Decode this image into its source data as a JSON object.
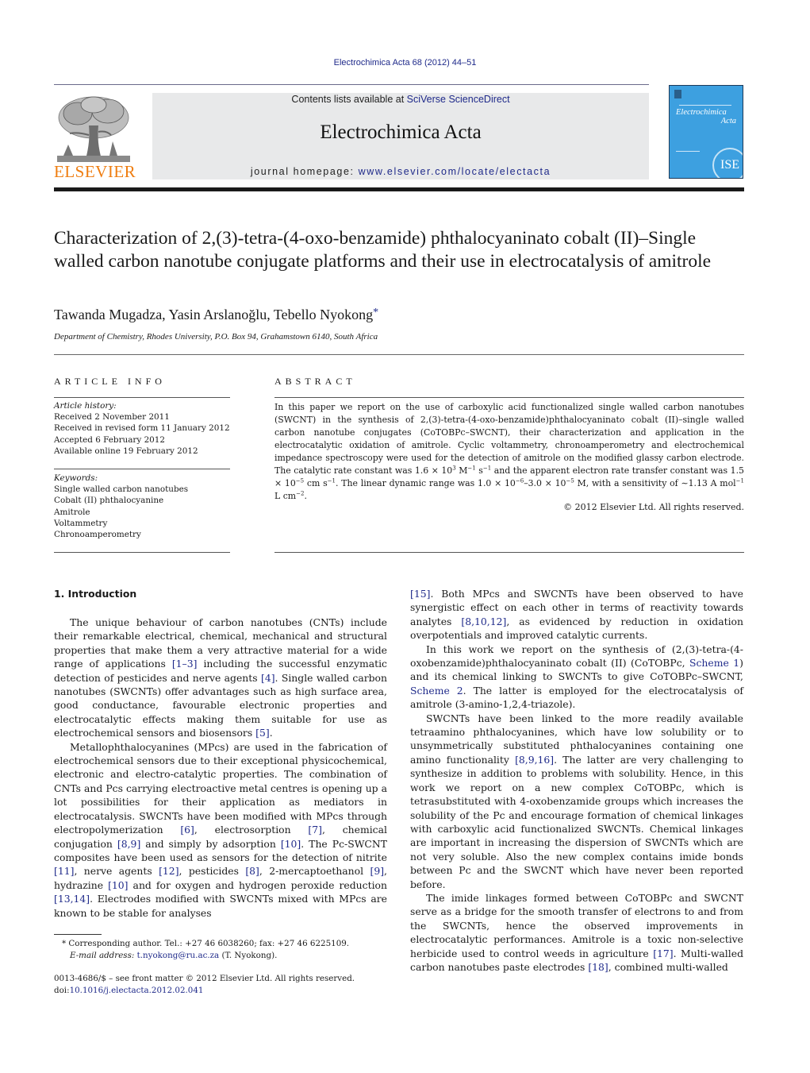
{
  "running_head": "Electrochimica Acta 68 (2012) 44–51",
  "header": {
    "publisher_logo_text": "ELSEVIER",
    "contents_prefix": "Contents lists available at ",
    "contents_link": "SciVerse ScienceDirect",
    "journal_title": "Electrochimica Acta",
    "homepage_prefix": "journal homepage: ",
    "homepage_link": "www.elsevier.com/locate/electacta",
    "cover_title_line1": "Electrochimica",
    "cover_title_line2": "Acta",
    "cover_badge": "ISE"
  },
  "article": {
    "title": "Characterization of 2,(3)-tetra-(4-oxo-benzamide) phthalocyaninato cobalt (II)–Single walled carbon nanotube conjugate platforms and their use in electrocatalysis of amitrole",
    "authors": "Tawanda Mugadza, Yasin Arslanoğlu, Tebello Nyokong",
    "corresponding_mark": "*",
    "affiliation": "Department of Chemistry, Rhodes University, P.O. Box 94, Grahamstown 6140, South Africa"
  },
  "article_info": {
    "heading": "ARTICLE INFO",
    "history_label": "Article history:",
    "history": [
      "Received 2 November 2011",
      "Received in revised form 11 January 2012",
      "Accepted 6 February 2012",
      "Available online 19 February 2012"
    ],
    "keywords_label": "Keywords:",
    "keywords": [
      "Single walled carbon nanotubes",
      "Cobalt (II) phthalocyanine",
      "Amitrole",
      "Voltammetry",
      "Chronoamperometry"
    ]
  },
  "abstract": {
    "heading": "ABSTRACT",
    "text_1": "In this paper we report on the use of carboxylic acid functionalized single walled carbon nanotubes (SWCNT) in the synthesis of 2,(3)-tetra-(4-oxo-benzamide)phthalocyaninato cobalt (II)–single walled carbon nanotube conjugates (CoTOBPc–SWCNT), their characterization and application in the electrocatalytic oxidation of amitrole. Cyclic voltammetry, chronoamperometry and electrochemical impedance spectroscopy were used for the detection of amitrole on the modified glassy carbon electrode. The catalytic rate constant was 1.6 × 10",
    "sup_1": "3",
    "text_2": " M",
    "sup_2": "−1",
    "text_3": " s",
    "sup_3": "−1",
    "text_4": " and the apparent electron rate transfer constant was 1.5 × 10",
    "sup_4": "−5",
    "text_5": " cm s",
    "sup_5": "−1",
    "text_6": ". The linear dynamic range was 1.0 × 10",
    "sup_6": "−6",
    "text_7": "–3.0 × 10",
    "sup_7": "−5",
    "text_8": " M, with a sensitivity of ∼1.13 A mol",
    "sup_8": "−1",
    "text_9": " L cm",
    "sup_9": "−2",
    "text_10": ".",
    "copyright": "© 2012 Elsevier Ltd. All rights reserved."
  },
  "body": {
    "section_heading": "1.  Introduction",
    "left": {
      "p1_a": "The unique behaviour of carbon nanotubes (CNTs) include their remarkable electrical, chemical, mechanical and structural properties that make them a very attractive material for a wide range of applications ",
      "p1_ref1": "[1–3]",
      "p1_b": " including the successful enzymatic detection of pesticides and nerve agents ",
      "p1_ref2": "[4]",
      "p1_c": ". Single walled carbon nanotubes (SWCNTs) offer advantages such as high surface area, good conductance, favourable electronic properties and electrocatalytic effects making them suitable for use as electrochemical sensors and biosensors ",
      "p1_ref3": "[5]",
      "p1_d": ".",
      "p2_a": "Metallophthalocyanines (MPcs) are used in the fabrication of electrochemical sensors due to their exceptional physicochemical, electronic and electro-catalytic properties. The combination of CNTs and Pcs carrying electroactive metal centres is opening up a lot possibilities for their application as mediators in electrocatalysis. SWCNTs have been modified with MPcs through electropolymerization ",
      "p2_ref1": "[6]",
      "p2_b": ", electrosorption ",
      "p2_ref2": "[7]",
      "p2_c": ", chemical conjugation ",
      "p2_ref3": "[8,9]",
      "p2_d": " and simply by adsorption ",
      "p2_ref4": "[10]",
      "p2_e": ". The Pc-SWCNT composites have been used as sensors for the detection of nitrite ",
      "p2_ref5": "[11]",
      "p2_f": ", nerve agents ",
      "p2_ref6": "[12]",
      "p2_g": ", pesticides ",
      "p2_ref7": "[8]",
      "p2_h": ", 2-mercaptoethanol ",
      "p2_ref8": "[9]",
      "p2_i": ", hydrazine ",
      "p2_ref9": "[10]",
      "p2_j": " and for oxygen and hydrogen peroxide reduction ",
      "p2_ref10": "[13,14]",
      "p2_k": ". Electrodes modified with SWCNTs mixed with MPcs are known to be stable for analyses"
    },
    "right": {
      "p1_ref1": "[15]",
      "p1_a": ". Both MPcs and SWCNTs have been observed to have synergistic effect on each other in terms of reactivity towards analytes ",
      "p1_ref2": "[8,10,12]",
      "p1_b": ", as evidenced by reduction in oxidation overpotentials and improved catalytic currents.",
      "p2_a": "In this work we report on the synthesis of (2,(3)-tetra-(4-oxobenzamide)phthalocyaninato cobalt (II) (CoTOBPc, ",
      "p2_ref1": "Scheme 1",
      "p2_b": ") and its chemical linking to SWCNTs to give CoTOBPc–SWCNT, ",
      "p2_ref2": "Scheme 2",
      "p2_c": ". The latter is employed for the electrocatalysis of amitrole (3-amino-1,2,4-triazole).",
      "p3_a": "SWCNTs have been linked to the more readily available tetraamino phthalocyanines, which have low solubility or to unsymmetrically substituted phthalocyanines containing one amino functionality ",
      "p3_ref1": "[8,9,16]",
      "p3_b": ". The latter are very challenging to synthesize in addition to problems with solubility. Hence, in this work we report on a new complex CoTOBPc, which is tetrasubstituted with 4-oxobenzamide groups which increases the solubility of the Pc and encourage formation of chemical linkages with carboxylic acid functionalized SWCNTs. Chemical linkages are important in increasing the dispersion of SWCNTs which are not very soluble. Also the new complex contains imide bonds between Pc and the SWCNT which have never been reported before.",
      "p4_a": "The imide linkages formed between CoTOBPc and SWCNT serve as a bridge for the smooth transfer of electrons to and from the SWCNTs, hence the observed improvements in electrocatalytic performances. Amitrole is a toxic non-selective herbicide used to control weeds in agriculture ",
      "p4_ref1": "[17]",
      "p4_b": ". Multi-walled carbon nanotubes paste electrodes ",
      "p4_ref2": "[18]",
      "p4_c": ", combined multi-walled"
    }
  },
  "footnote": {
    "mark": "*",
    "corresponding": " Corresponding author. Tel.: +27 46 6038260; fax: +27 46 6225109.",
    "email_label": "E-mail address:",
    "email": "t.nyokong@ru.ac.za",
    "email_suffix": " (T. Nyokong)."
  },
  "front_matter": {
    "issn_line": "0013-4686/$ – see front matter © 2012 Elsevier Ltd. All rights reserved.",
    "doi_prefix": "doi:",
    "doi": "10.1016/j.electacta.2012.02.041"
  },
  "colors": {
    "link": "#1f2a8a",
    "elsevier_orange": "#ef7d10",
    "banner_gray": "#e8e9ea",
    "cover_blue": "#3da0e0"
  }
}
